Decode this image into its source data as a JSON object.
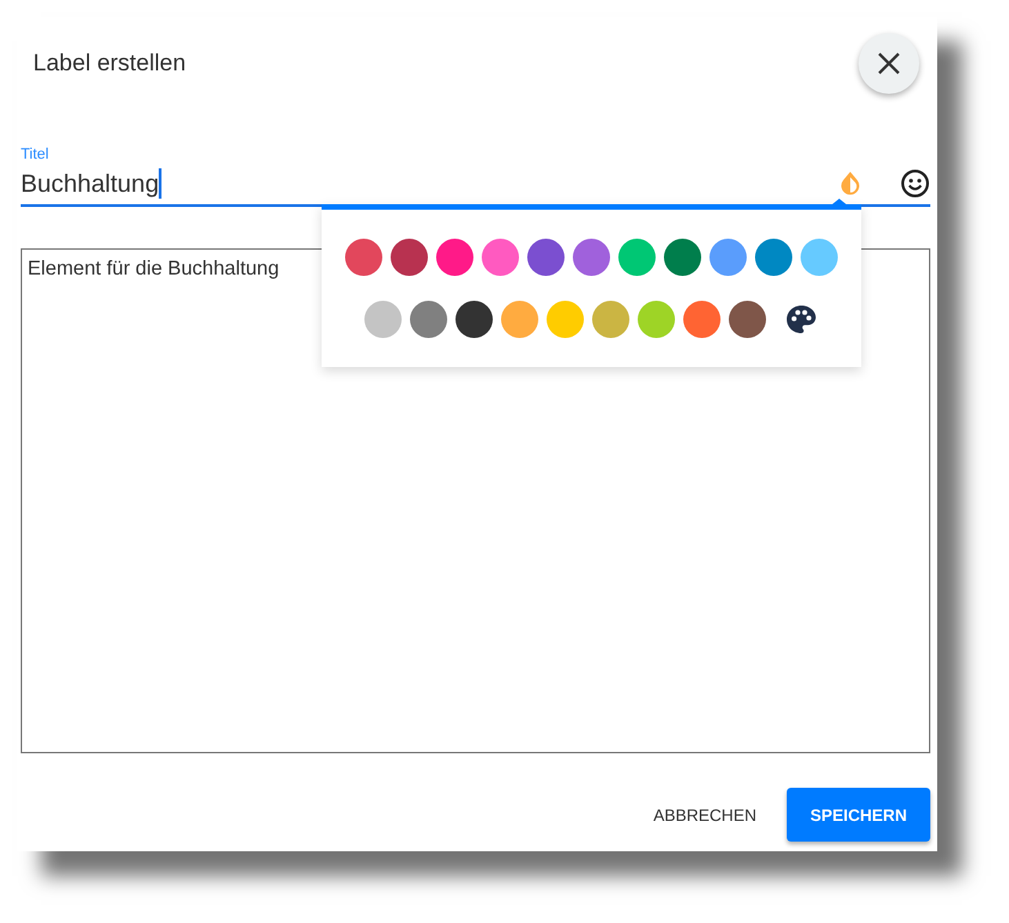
{
  "dialog": {
    "title": "Label erstellen"
  },
  "title_field": {
    "label": "Titel",
    "value": "Buchhaltung",
    "focused": true
  },
  "description_field": {
    "value": "Element für die Buchhaltung"
  },
  "color_picker": {
    "open": true,
    "swatches": [
      {
        "color": "#e2475c"
      },
      {
        "color": "#b83250"
      },
      {
        "color": "#ff1a88"
      },
      {
        "color": "#ff5ac0"
      },
      {
        "color": "#7b4fd0"
      },
      {
        "color": "#a061dc"
      },
      {
        "color": "#00c774"
      },
      {
        "color": "#007e4c"
      },
      {
        "color": "#5a9dfc"
      },
      {
        "color": "#0088c2"
      },
      {
        "color": "#66caff"
      },
      {
        "color": "#c4c4c4"
      },
      {
        "color": "#808080"
      },
      {
        "color": "#333333"
      },
      {
        "color": "#ffab40"
      },
      {
        "color": "#ffcc00"
      },
      {
        "color": "#cbb543"
      },
      {
        "color": "#9ed426"
      },
      {
        "color": "#ff6433"
      },
      {
        "color": "#7f5649"
      }
    ]
  },
  "buttons": [
    {
      "label": "ABBRECHEN",
      "kind": "text"
    },
    {
      "label": "SPEICHERN",
      "kind": "primary"
    }
  ]
}
